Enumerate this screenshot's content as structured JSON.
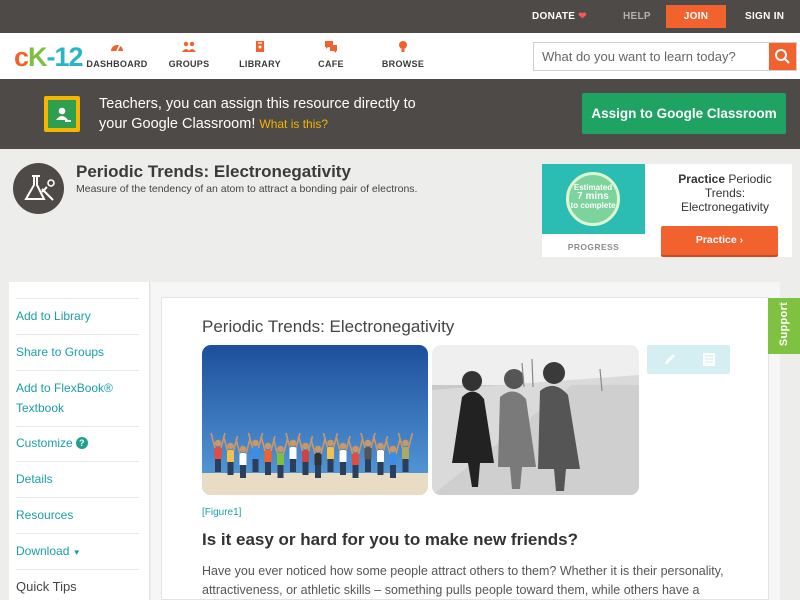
{
  "topbar": {
    "donate": "DONATE",
    "help": "HELP",
    "join": "JOIN",
    "signin": "SIGN IN"
  },
  "nav": {
    "logo": {
      "c": "c",
      "k": "K",
      "n": "-12"
    },
    "items": [
      {
        "label": "DASHBOARD",
        "icon": "dashboard-icon"
      },
      {
        "label": "GROUPS",
        "icon": "groups-icon"
      },
      {
        "label": "LIBRARY",
        "icon": "library-icon"
      },
      {
        "label": "CAFE",
        "icon": "cafe-icon"
      },
      {
        "label": "BROWSE",
        "icon": "browse-icon"
      }
    ],
    "search_placeholder": "What do you want to learn today?"
  },
  "banner": {
    "line1": "Teachers, you can assign this resource directly to",
    "line2": "your Google Classroom!",
    "what": "What is this?",
    "button": "Assign to Google Classroom"
  },
  "concept": {
    "title": "Periodic Trends: Electronegativity",
    "description": "Measure of the tendency of an atom to attract a bonding pair of electrons."
  },
  "practice": {
    "estimated_top": "Estimated",
    "estimated_mid": "7 mins",
    "estimated_bottom": "to complete",
    "progress": "PROGRESS",
    "title_bold": "Practice",
    "title_rest": " Periodic Trends: Electronegativity",
    "button": "Practice"
  },
  "sidebar": {
    "items": [
      "Add to Library",
      "Share to Groups",
      "Add to FlexBook®",
      "Textbook",
      "Customize",
      "Details",
      "Resources",
      "Download"
    ],
    "quick_tips": "Quick Tips"
  },
  "article": {
    "title": "Periodic Trends: Electronegativity",
    "figure": "[Figure1]",
    "question": "Is it easy or hard for you to make new friends?",
    "para1": "Have you ever noticed how some people attract others to them? Whether it is their personality,",
    "para2": "attractiveness, or athletic skills – something pulls people toward them, while others have a"
  },
  "support": "Support",
  "colors": {
    "accent": "#f2622e",
    "teal": "#1a9fa6",
    "green": "#1fa363",
    "dark": "#4d4a47"
  }
}
